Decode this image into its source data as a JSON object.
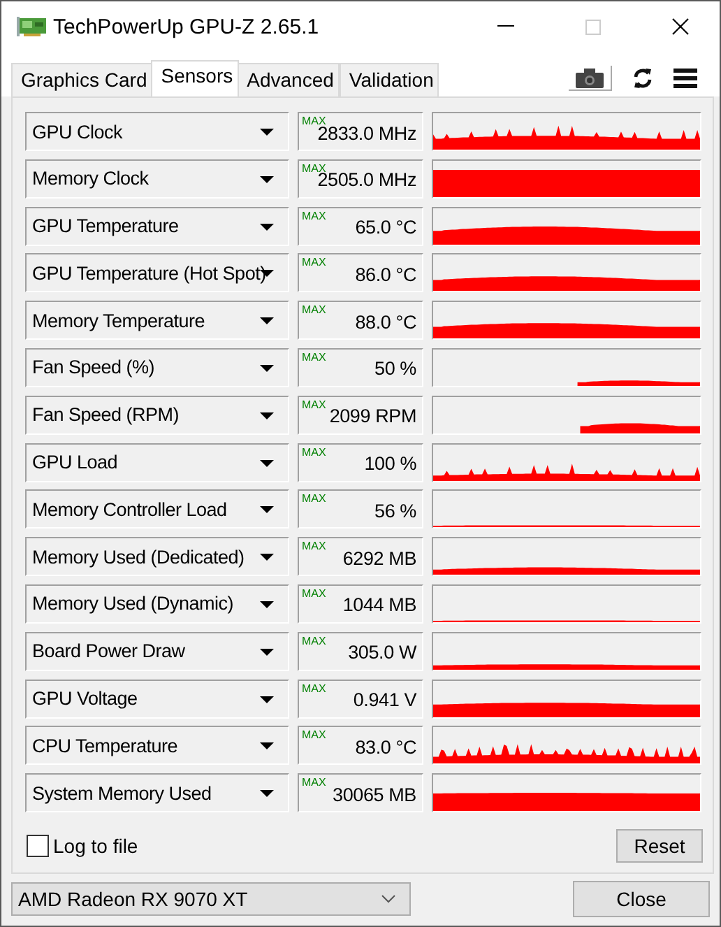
{
  "window": {
    "title": "TechPowerUp GPU-Z 2.65.1"
  },
  "tabs": [
    {
      "label": "Graphics Card",
      "selected": false
    },
    {
      "label": "Sensors",
      "selected": true
    },
    {
      "label": "Advanced",
      "selected": false
    },
    {
      "label": "Validation",
      "selected": false
    }
  ],
  "sensors": [
    {
      "name": "GPU Clock",
      "max_label": "MAX",
      "value": "2833.0 MHz"
    },
    {
      "name": "Memory Clock",
      "max_label": "MAX",
      "value": "2505.0 MHz"
    },
    {
      "name": "GPU Temperature",
      "max_label": "MAX",
      "value": "65.0 °C"
    },
    {
      "name": "GPU Temperature (Hot Spot)",
      "max_label": "MAX",
      "value": "86.0 °C"
    },
    {
      "name": "Memory Temperature",
      "max_label": "MAX",
      "value": "88.0 °C"
    },
    {
      "name": "Fan Speed (%)",
      "max_label": "MAX",
      "value": "50 %"
    },
    {
      "name": "Fan Speed (RPM)",
      "max_label": "MAX",
      "value": "2099 RPM"
    },
    {
      "name": "GPU Load",
      "max_label": "MAX",
      "value": "100 %"
    },
    {
      "name": "Memory Controller Load",
      "max_label": "MAX",
      "value": "56 %"
    },
    {
      "name": "Memory Used (Dedicated)",
      "max_label": "MAX",
      "value": "6292 MB"
    },
    {
      "name": "Memory Used (Dynamic)",
      "max_label": "MAX",
      "value": "1044 MB"
    },
    {
      "name": "Board Power Draw",
      "max_label": "MAX",
      "value": "305.0 W"
    },
    {
      "name": "GPU Voltage",
      "max_label": "MAX",
      "value": "0.941 V"
    },
    {
      "name": "CPU Temperature",
      "max_label": "MAX",
      "value": "83.0 °C"
    },
    {
      "name": "System Memory Used",
      "max_label": "MAX",
      "value": "30065 MB"
    }
  ],
  "log_to_file": {
    "label": "Log to file",
    "checked": false
  },
  "reset_button": "Reset",
  "gpu_select": {
    "value": "AMD Radeon RX 9070 XT"
  },
  "close_button": "Close"
}
